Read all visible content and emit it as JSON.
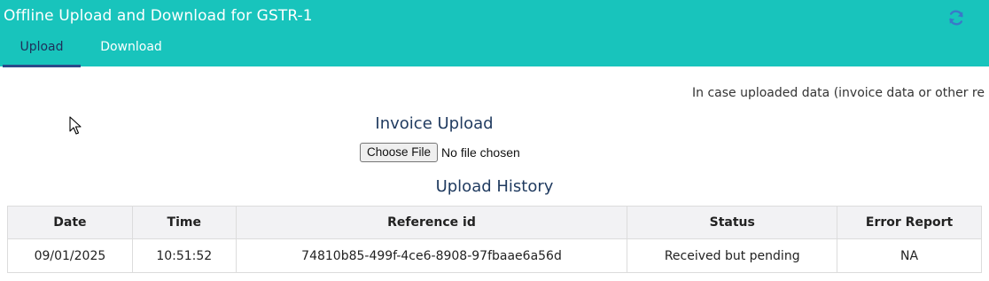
{
  "header": {
    "title": "Offline Upload and Download for GSTR-1",
    "refresh_icon": "refresh-icon",
    "background_color": "#18c4bc"
  },
  "tabs": [
    {
      "label": "Upload",
      "active": true
    },
    {
      "label": "Download",
      "active": false
    }
  ],
  "notice": {
    "text": "In case uploaded data (invoice data or other re"
  },
  "invoice_upload": {
    "title": "Invoice Upload",
    "choose_file_label": "Choose File",
    "no_file_text": "No file chosen"
  },
  "upload_history": {
    "title": "Upload History",
    "columns": [
      "Date",
      "Time",
      "Reference id",
      "Status",
      "Error Report"
    ],
    "rows": [
      {
        "date": "09/01/2025",
        "time": "10:51:52",
        "reference_id": "74810b85-499f-4ce6-8908-97fbaae6a56d",
        "status": "Received but pending",
        "error_report": "NA"
      }
    ]
  }
}
